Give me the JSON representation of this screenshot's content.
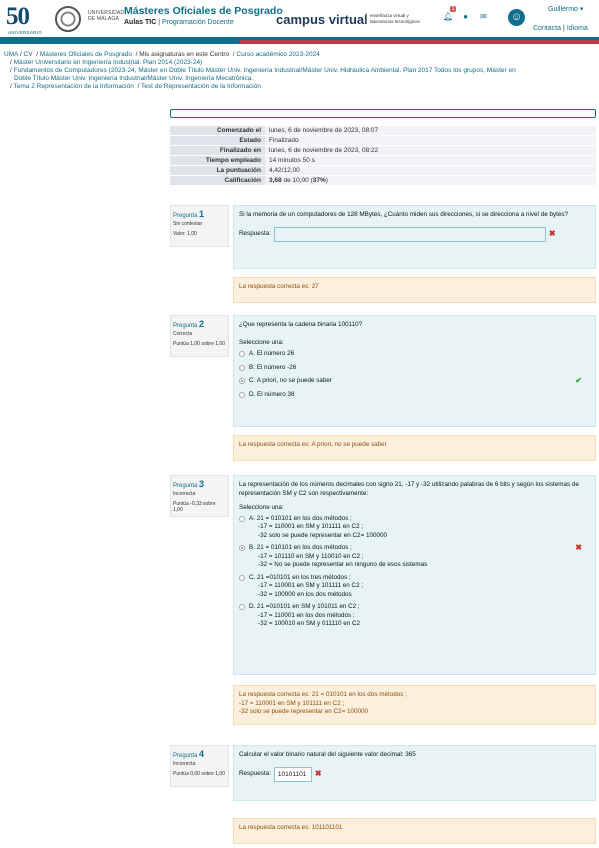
{
  "header": {
    "anniversary_num": "50",
    "anniversary_label": "ANIVERSARIO",
    "uma_line1": "UNIVERSIDAD",
    "uma_line2": "DE MÁLAGA",
    "site_title": "Másteres Oficiales de Posgrado",
    "site_sub_bold": "Aulas TIC",
    "site_sub_sep": "|",
    "site_sub": "Programación Docente",
    "cv_logo": "campus virtual",
    "cv_tag_line1": "enseñanza virtual y",
    "cv_tag_line2": "laboratorios tecnológicos",
    "notif_count": "1",
    "user_name": "Guillermo",
    "link_contact": "Contacta",
    "link_lang": "Idioma",
    "links_sep": "|"
  },
  "breadcrumb": {
    "row1": [
      "UMA",
      "CV",
      "Másteres Oficiales de Posgrado",
      "Mis asignaturas en este Centro",
      "Curso académico 2023-2024"
    ],
    "row2": "Máster Universitario en Ingeniería Industrial. Plan 2014 (2023-24)",
    "row3": "Fundamentos de Computadores (2023-24, Máster en Doble Título Máster Univ. Ingeniería Industrial/Máster Univ. Hidráulica Ambiental. Plan 2017 Todos los grupos, Máster en",
    "row4": "Doble Título Máster Univ. Ingeniería Industrial/Máster Univ. Ingeniería Mecatrónica.",
    "row5a": "Tema 2 Representación de la Información",
    "row5b": "Test de Representación de la Información"
  },
  "summary": [
    {
      "label": "Comenzado el",
      "value": "lunes, 6 de noviembre de 2023, 08:07"
    },
    {
      "label": "Estado",
      "value": "Finalizado"
    },
    {
      "label": "Finalizado en",
      "value": "lunes, 6 de noviembre de 2023, 08:22"
    },
    {
      "label": "Tiempo empleado",
      "value": "14 minutos 50 s"
    },
    {
      "label": "La puntuación",
      "value": "4,42/12,00"
    },
    {
      "label": "Calificación",
      "value_bold": "3,68",
      "value_mid": " de 10,00 (",
      "value_pct": "37%",
      "value_end": ")"
    }
  ],
  "questions": [
    {
      "prefix": "Pregunta",
      "num": "1",
      "status": "Sin contestar",
      "marks": "Valor: 1,00",
      "text": "Si la memoria de un computadores de 128 MBytes, ¿Cuánto miden sus direcciones, si se direcciona a nivel de bytes?",
      "answer_label": "Respuesta:",
      "answer_value": "",
      "feedback": "La respuesta correcta es: 27"
    },
    {
      "prefix": "Pregunta",
      "num": "2",
      "status": "Correcta",
      "marks": "Puntúa 1,00 sobre 1,00",
      "text": "¿Que representa la cadena binaria 100110?",
      "select_label": "Seleccione una:",
      "options": [
        "A. El número 26",
        "B. El número -26",
        "C. A priori, no se puede saber",
        "D. El número 38"
      ],
      "feedback": "La respuesta correcta es: A priori, no se puede saber"
    },
    {
      "prefix": "Pregunta",
      "num": "3",
      "status": "Incorrecta",
      "marks": "Puntúa -0,33 sobre 1,00",
      "text": "La representación de los números decimales con signo 21, -17 y -32 utilizando palabras de 6 bits y según los sistemas de representación SM y C2 son respectivamente:",
      "select_label": "Seleccione una:",
      "options": [
        [
          "A. 21 = 010101 en los dos métodos ;",
          "-17 = 110001 en SM y 101111 en C2 ;",
          "-32 solo se puede representar en C2= 100000"
        ],
        [
          "B. 21 = 010101 en los dos métodos ;",
          "-17 = 101110 en SM y 110010 en C2 ;",
          "-32 = No se puede representar en ninguno de esos sistemas"
        ],
        [
          "C. 21 =010101 en los tres métodos ;",
          "-17 = 110001 en SM y 101111 en C2 ;",
          "-32 = 100000 en los dos métodos"
        ],
        [
          "D. 21 =010101 en SM y 101011 en C2 ;",
          "-17 = 110001 en los dos métodos ;",
          "-32 = 100010 en SM y 011110 en C2"
        ]
      ],
      "feedback_lines": [
        "La respuesta correcta es: 21 = 010101 en los dos métodos ;",
        "-17 = 110001 en SM y 101111 en C2 ;",
        "-32 solo se puede representar en C2= 100000"
      ]
    },
    {
      "prefix": "Pregunta",
      "num": "4",
      "status": "Incorrecta",
      "marks": "Puntúa 0,00 sobre 1,00",
      "text": "Calcular el valor binario natural del siguiente valor decimal: 365",
      "answer_label": "Respuesta:",
      "answer_value": "10101101",
      "feedback": "La respuesta correcta es: 101101101"
    }
  ]
}
